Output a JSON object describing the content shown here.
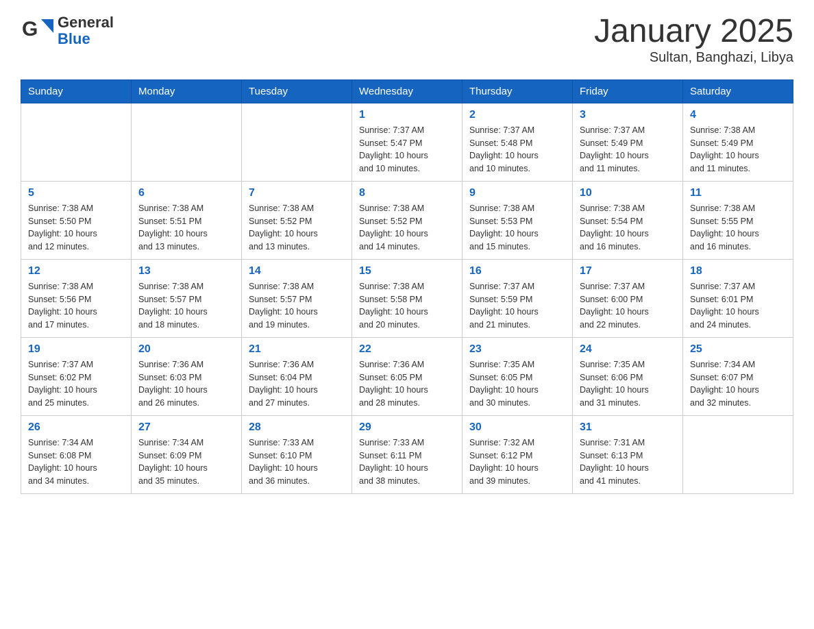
{
  "logo": {
    "text_general": "General",
    "text_blue": "Blue"
  },
  "title": "January 2025",
  "subtitle": "Sultan, Banghazi, Libya",
  "days_of_week": [
    "Sunday",
    "Monday",
    "Tuesday",
    "Wednesday",
    "Thursday",
    "Friday",
    "Saturday"
  ],
  "weeks": [
    [
      {
        "day": "",
        "info": ""
      },
      {
        "day": "",
        "info": ""
      },
      {
        "day": "",
        "info": ""
      },
      {
        "day": "1",
        "info": "Sunrise: 7:37 AM\nSunset: 5:47 PM\nDaylight: 10 hours\nand 10 minutes."
      },
      {
        "day": "2",
        "info": "Sunrise: 7:37 AM\nSunset: 5:48 PM\nDaylight: 10 hours\nand 10 minutes."
      },
      {
        "day": "3",
        "info": "Sunrise: 7:37 AM\nSunset: 5:49 PM\nDaylight: 10 hours\nand 11 minutes."
      },
      {
        "day": "4",
        "info": "Sunrise: 7:38 AM\nSunset: 5:49 PM\nDaylight: 10 hours\nand 11 minutes."
      }
    ],
    [
      {
        "day": "5",
        "info": "Sunrise: 7:38 AM\nSunset: 5:50 PM\nDaylight: 10 hours\nand 12 minutes."
      },
      {
        "day": "6",
        "info": "Sunrise: 7:38 AM\nSunset: 5:51 PM\nDaylight: 10 hours\nand 13 minutes."
      },
      {
        "day": "7",
        "info": "Sunrise: 7:38 AM\nSunset: 5:52 PM\nDaylight: 10 hours\nand 13 minutes."
      },
      {
        "day": "8",
        "info": "Sunrise: 7:38 AM\nSunset: 5:52 PM\nDaylight: 10 hours\nand 14 minutes."
      },
      {
        "day": "9",
        "info": "Sunrise: 7:38 AM\nSunset: 5:53 PM\nDaylight: 10 hours\nand 15 minutes."
      },
      {
        "day": "10",
        "info": "Sunrise: 7:38 AM\nSunset: 5:54 PM\nDaylight: 10 hours\nand 16 minutes."
      },
      {
        "day": "11",
        "info": "Sunrise: 7:38 AM\nSunset: 5:55 PM\nDaylight: 10 hours\nand 16 minutes."
      }
    ],
    [
      {
        "day": "12",
        "info": "Sunrise: 7:38 AM\nSunset: 5:56 PM\nDaylight: 10 hours\nand 17 minutes."
      },
      {
        "day": "13",
        "info": "Sunrise: 7:38 AM\nSunset: 5:57 PM\nDaylight: 10 hours\nand 18 minutes."
      },
      {
        "day": "14",
        "info": "Sunrise: 7:38 AM\nSunset: 5:57 PM\nDaylight: 10 hours\nand 19 minutes."
      },
      {
        "day": "15",
        "info": "Sunrise: 7:38 AM\nSunset: 5:58 PM\nDaylight: 10 hours\nand 20 minutes."
      },
      {
        "day": "16",
        "info": "Sunrise: 7:37 AM\nSunset: 5:59 PM\nDaylight: 10 hours\nand 21 minutes."
      },
      {
        "day": "17",
        "info": "Sunrise: 7:37 AM\nSunset: 6:00 PM\nDaylight: 10 hours\nand 22 minutes."
      },
      {
        "day": "18",
        "info": "Sunrise: 7:37 AM\nSunset: 6:01 PM\nDaylight: 10 hours\nand 24 minutes."
      }
    ],
    [
      {
        "day": "19",
        "info": "Sunrise: 7:37 AM\nSunset: 6:02 PM\nDaylight: 10 hours\nand 25 minutes."
      },
      {
        "day": "20",
        "info": "Sunrise: 7:36 AM\nSunset: 6:03 PM\nDaylight: 10 hours\nand 26 minutes."
      },
      {
        "day": "21",
        "info": "Sunrise: 7:36 AM\nSunset: 6:04 PM\nDaylight: 10 hours\nand 27 minutes."
      },
      {
        "day": "22",
        "info": "Sunrise: 7:36 AM\nSunset: 6:05 PM\nDaylight: 10 hours\nand 28 minutes."
      },
      {
        "day": "23",
        "info": "Sunrise: 7:35 AM\nSunset: 6:05 PM\nDaylight: 10 hours\nand 30 minutes."
      },
      {
        "day": "24",
        "info": "Sunrise: 7:35 AM\nSunset: 6:06 PM\nDaylight: 10 hours\nand 31 minutes."
      },
      {
        "day": "25",
        "info": "Sunrise: 7:34 AM\nSunset: 6:07 PM\nDaylight: 10 hours\nand 32 minutes."
      }
    ],
    [
      {
        "day": "26",
        "info": "Sunrise: 7:34 AM\nSunset: 6:08 PM\nDaylight: 10 hours\nand 34 minutes."
      },
      {
        "day": "27",
        "info": "Sunrise: 7:34 AM\nSunset: 6:09 PM\nDaylight: 10 hours\nand 35 minutes."
      },
      {
        "day": "28",
        "info": "Sunrise: 7:33 AM\nSunset: 6:10 PM\nDaylight: 10 hours\nand 36 minutes."
      },
      {
        "day": "29",
        "info": "Sunrise: 7:33 AM\nSunset: 6:11 PM\nDaylight: 10 hours\nand 38 minutes."
      },
      {
        "day": "30",
        "info": "Sunrise: 7:32 AM\nSunset: 6:12 PM\nDaylight: 10 hours\nand 39 minutes."
      },
      {
        "day": "31",
        "info": "Sunrise: 7:31 AM\nSunset: 6:13 PM\nDaylight: 10 hours\nand 41 minutes."
      },
      {
        "day": "",
        "info": ""
      }
    ]
  ]
}
